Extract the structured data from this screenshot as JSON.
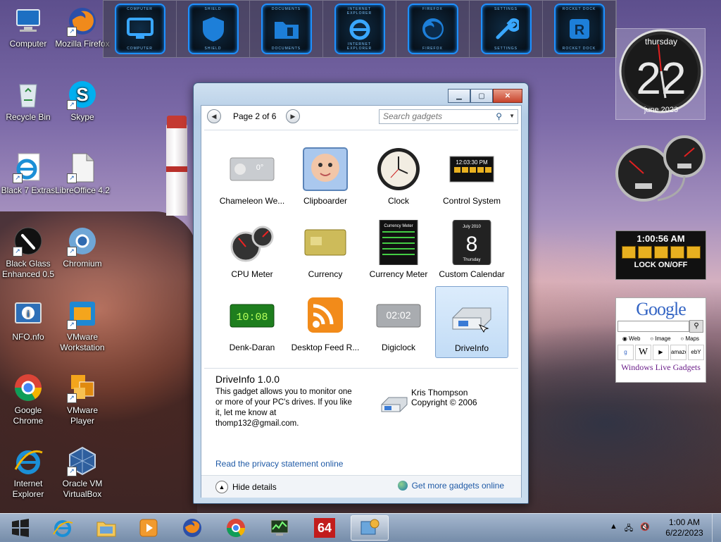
{
  "desktop": {
    "icons": [
      {
        "label": "Computer"
      },
      {
        "label": "Mozilla Firefox"
      },
      {
        "label": "Recycle Bin"
      },
      {
        "label": "Skype"
      },
      {
        "label": "Black 7 Extras"
      },
      {
        "label": "LibreOffice 4.2"
      },
      {
        "label": "Black Glass Enhanced 0.5"
      },
      {
        "label": "Chromium"
      },
      {
        "label": "NFO.nfo"
      },
      {
        "label": "VMware Workstation"
      },
      {
        "label": "Google Chrome"
      },
      {
        "label": "VMware Player"
      },
      {
        "label": "Internet Explorer"
      },
      {
        "label": "Oracle VM VirtualBox"
      }
    ]
  },
  "dock": {
    "items": [
      {
        "label": "COMPUTER"
      },
      {
        "label": "SHIELD"
      },
      {
        "label": "DOCUMENTS"
      },
      {
        "label": "INTERNET EXPLORER"
      },
      {
        "label": "FIREFOX"
      },
      {
        "label": "SETTINGS"
      },
      {
        "label": "ROCKET DOCK"
      }
    ]
  },
  "gadgets_right": {
    "clock_day": "thursday",
    "clock_date": "22",
    "clock_month": "june 2023",
    "ctrl_time": "1:00:56 AM",
    "ctrl_lock": "LOCK ON/OFF",
    "google_logo": "Google",
    "google_radio_web": "Web",
    "google_radio_image": "Image",
    "google_radio_maps": "Maps",
    "google_logo_amazon": "amazon",
    "google_logo_ebay": "ebY",
    "google_footer": "Windows Live Gadgets"
  },
  "window": {
    "page_label": "Page 2 of 6",
    "search_placeholder": "Search gadgets",
    "gadgets": [
      {
        "label": "Chameleon We..."
      },
      {
        "label": "Clipboarder"
      },
      {
        "label": "Clock"
      },
      {
        "label": "Control System"
      },
      {
        "label": "CPU Meter"
      },
      {
        "label": "Currency"
      },
      {
        "label": "Currency Meter"
      },
      {
        "label": "Custom Calendar"
      },
      {
        "label": "Denk-Daran"
      },
      {
        "label": "Desktop Feed R..."
      },
      {
        "label": "Digiclock"
      },
      {
        "label": "DriveInfo"
      }
    ],
    "thumb_text": {
      "chameleon": "0°",
      "control_time": "12:03:30 PM",
      "currency_meter": "Currency Meter",
      "calendar_month": "July 2010",
      "calendar_day": "8",
      "calendar_weekday": "Thursday",
      "denk": "10:08",
      "digiclock": "02:02"
    },
    "details": {
      "title": "DriveInfo 1.0.0",
      "description": "This gadget allows you to monitor one or more of your PC's drives. If you like it, let me know at thomp132@gmail.com.",
      "author": "Kris Thompson",
      "copyright": "Copyright © 2006",
      "privacy_link": "Read the privacy statement online"
    },
    "footer": {
      "hide_details": "Hide details",
      "get_more": "Get more gadgets online"
    }
  },
  "taskbar": {
    "badge_64": "64",
    "time": "1:00 AM",
    "date": "6/22/2023"
  }
}
